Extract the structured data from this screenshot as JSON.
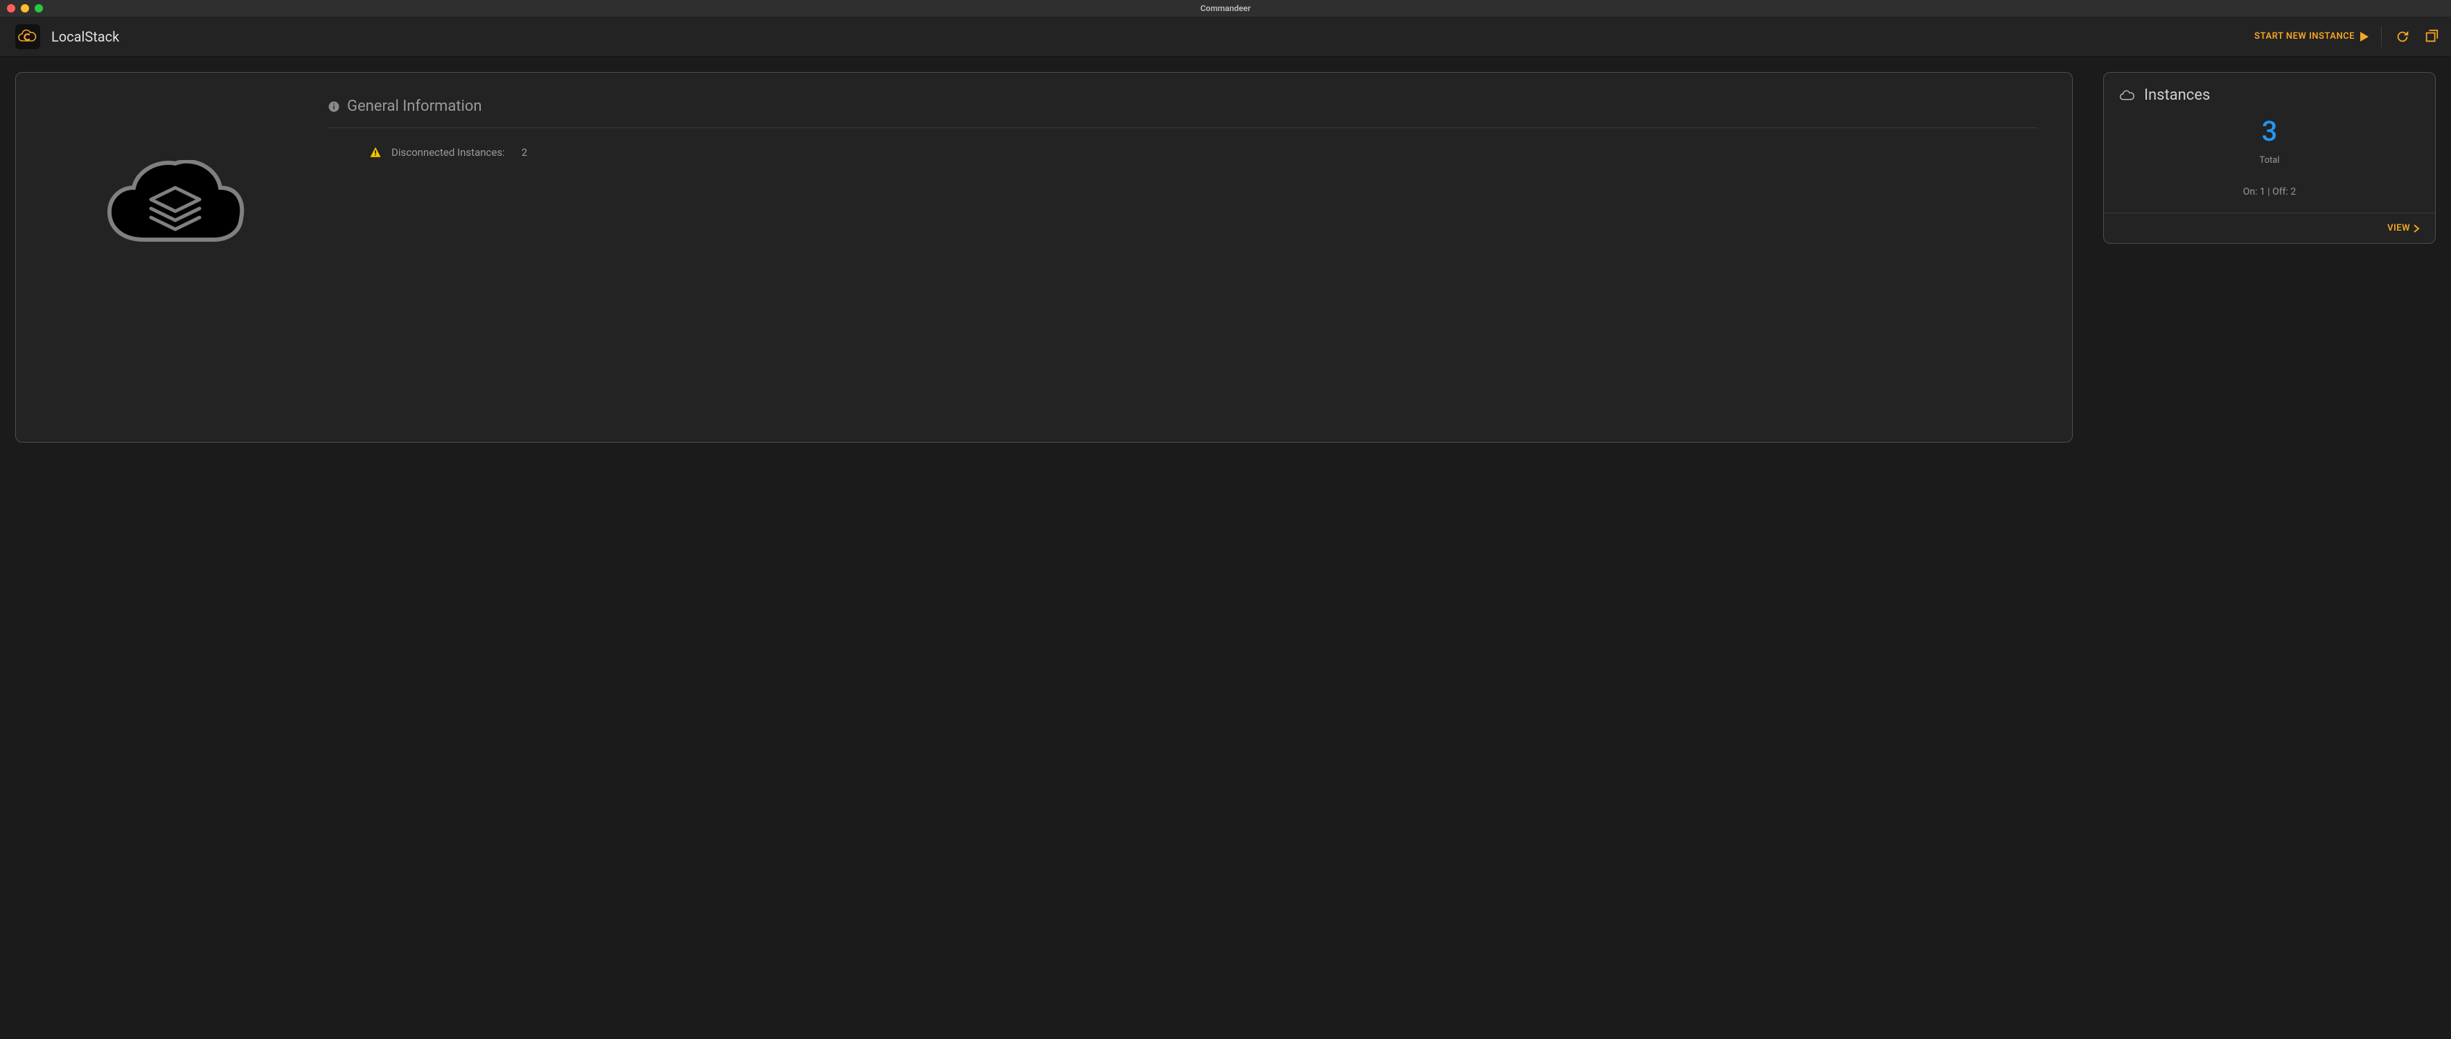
{
  "window": {
    "title": "Commandeer"
  },
  "header": {
    "page_title": "LocalStack",
    "start_label": "START NEW INSTANCE"
  },
  "main": {
    "section_title": "General Information",
    "disconnected_label": "Disconnected Instances:",
    "disconnected_count": "2"
  },
  "side": {
    "title": "Instances",
    "total_value": "3",
    "total_label": "Total",
    "status_line": "On: 1 | Off: 2",
    "view_label": "VIEW"
  }
}
